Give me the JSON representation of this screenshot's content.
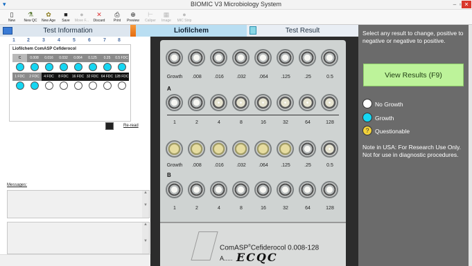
{
  "window": {
    "title": "BIOMIC V3 Microbiology System"
  },
  "toolbar": [
    {
      "label": "New",
      "icon": "new-doc-icon",
      "enabled": true
    },
    {
      "label": "New QC",
      "icon": "flask-icon",
      "enabled": true
    },
    {
      "label": "New Age",
      "icon": "sample-icon",
      "enabled": true
    },
    {
      "label": "Save",
      "icon": "save-icon",
      "enabled": true
    },
    {
      "label": "Move F...",
      "icon": "move-icon",
      "enabled": false
    },
    {
      "label": "Discard",
      "icon": "discard-icon",
      "enabled": true
    },
    {
      "label": "Print",
      "icon": "print-icon",
      "enabled": true
    },
    {
      "label": "Preview",
      "icon": "preview-icon",
      "enabled": true
    },
    {
      "label": "Caliper",
      "icon": "caliper-icon",
      "enabled": false
    },
    {
      "label": "Image",
      "icon": "image-icon",
      "enabled": false
    },
    {
      "label": "MIC Strip",
      "icon": "strip-icon",
      "enabled": false
    }
  ],
  "tabs": [
    {
      "label": "Test Information"
    },
    {
      "label": "Liofilchem"
    },
    {
      "label": "Test Result"
    }
  ],
  "panel": {
    "title": "Liofilchem ComASP Cefiderocol",
    "col_numbers": [
      "1",
      "2",
      "3",
      "4",
      "5",
      "6",
      "7",
      "8"
    ],
    "rowC": {
      "label": "C",
      "concs": [
        "0.008 FDC",
        "0.016 FDC",
        "0.032 FDC",
        "0.064 FDC",
        "0.125 FDC",
        "0.25 FDC",
        "0.5 FDC"
      ],
      "wells": [
        "g",
        "g",
        "g",
        "g",
        "g",
        "g",
        "g",
        "g"
      ]
    },
    "rowD": {
      "concs": [
        "1 FDC",
        "2 FDC",
        "4 FDC",
        "8 FDC",
        "16 FDC",
        "32 FDC",
        "64 FDC",
        "128 FDC"
      ],
      "wells": [
        "g",
        "g",
        "n",
        "n",
        "n",
        "n",
        "n",
        "n"
      ]
    },
    "reread_label": "Re-read",
    "messages_label": "Messages:"
  },
  "plate": {
    "rowA_labels": [
      "Growth",
      ".008",
      ".016",
      ".032",
      ".064",
      ".125",
      ".25",
      "0.5"
    ],
    "rowA2_labels": [
      "1",
      "2",
      "4",
      "8",
      "16",
      "32",
      "64",
      "128"
    ],
    "rowB_labels": [
      "Growth",
      ".008",
      ".016",
      ".032",
      ".064",
      ".125",
      ".25",
      "0.5"
    ],
    "rowB2_labels": [
      "1",
      "2",
      "4",
      "8",
      "16",
      "32",
      "64",
      "128"
    ],
    "letterA": "A",
    "letterB": "B",
    "product": "ComASP",
    "product_rest": "Cefiderocol 0.008-128",
    "lot": "A.....",
    "handwriting": "ECQC"
  },
  "sidebar": {
    "instruction": "Select any result to change, positive to negative or negative to positive.",
    "view_button": "View Results (F9)",
    "legend": [
      {
        "label": "No Growth",
        "color": "#ffffff"
      },
      {
        "label": "Growth",
        "color": "#15d6f2"
      },
      {
        "label": "Questionable",
        "color": "#f3d23a"
      }
    ],
    "note": "Note in USA: For Research Use Only. Not for use in diagnostic procedures."
  },
  "colors": {
    "growth": "#15d6f2",
    "accent_button": "#bdf39a",
    "sidebar_bg": "#6b6b6b"
  }
}
